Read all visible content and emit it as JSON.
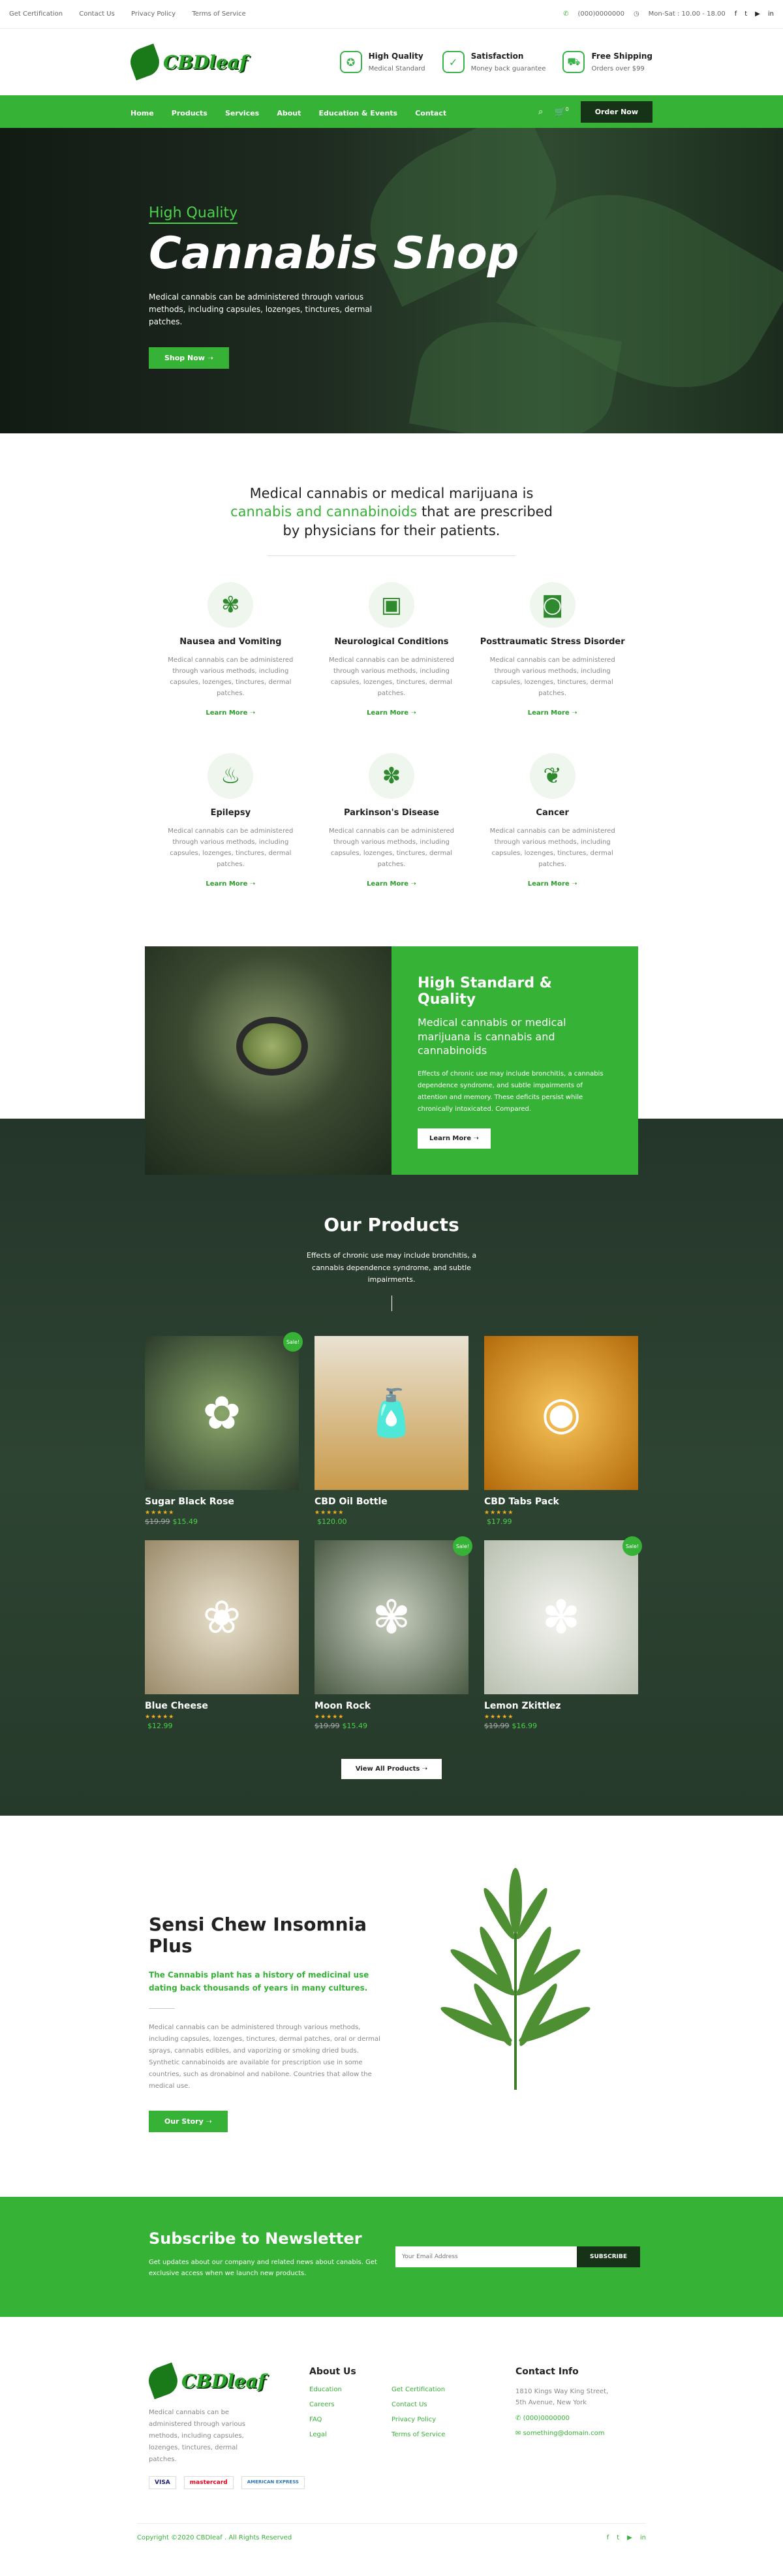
{
  "topbar": {
    "links": [
      "Get Certification",
      "Contact Us",
      "Privacy Policy",
      "Terms of Service"
    ],
    "phone": "(000)0000000",
    "hours": "Mon-Sat : 10.00 - 18.00"
  },
  "header": {
    "logo_text": "CBDleaf",
    "features": [
      {
        "icon": "award-icon",
        "title": "High Quality",
        "subtitle": "Medical Standard"
      },
      {
        "icon": "shield-check-icon",
        "title": "Satisfaction",
        "subtitle": "Money back guarantee"
      },
      {
        "icon": "truck-icon",
        "title": "Free Shipping",
        "subtitle": "Orders over $99"
      }
    ]
  },
  "nav": {
    "items": [
      "Home",
      "Products",
      "Services",
      "About",
      "Education & Events",
      "Contact"
    ],
    "cart_count": "0",
    "order_label": "Order Now"
  },
  "hero": {
    "eyebrow": "High Quality",
    "title": "Cannabis Shop",
    "text": "Medical cannabis can be administered through various methods, including capsules, lozenges, tinctures, dermal patches.",
    "button": "Shop Now"
  },
  "conditions": {
    "lead_1": "Medical cannabis or medical marijuana is",
    "lead_highlight": "cannabis and cannabinoids",
    "lead_2": "that are prescribed by physicians for their patients.",
    "items": [
      {
        "title": "Nausea and Vomiting",
        "text": "Medical cannabis can be administered through various methods, including capsules, lozenges, tinctures, dermal patches.",
        "more": "Learn More"
      },
      {
        "title": "Neurological Conditions",
        "text": "Medical cannabis can be administered through various methods, including capsules, lozenges, tinctures, dermal patches.",
        "more": "Learn More"
      },
      {
        "title": "Posttraumatic Stress Disorder",
        "text": "Medical cannabis can be administered through various methods, including capsules, lozenges, tinctures, dermal patches.",
        "more": "Learn More"
      },
      {
        "title": "Epilepsy",
        "text": "Medical cannabis can be administered through various methods, including capsules, lozenges, tinctures, dermal patches.",
        "more": "Learn More"
      },
      {
        "title": "Parkinson's Disease",
        "text": "Medical cannabis can be administered through various methods, including capsules, lozenges, tinctures, dermal patches.",
        "more": "Learn More"
      },
      {
        "title": "Cancer",
        "text": "Medical cannabis can be administered through various methods, including capsules, lozenges, tinctures, dermal patches.",
        "more": "Learn More"
      }
    ]
  },
  "quality": {
    "title": "High Standard & Quality",
    "subtitle": "Medical cannabis or medical marijuana is cannabis and cannabinoids",
    "text": "Effects of chronic use may include bronchitis, a cannabis dependence syndrome, and subtle impairments of attention and memory. These deficits persist while chronically intoxicated. Compared.",
    "button": "Learn More"
  },
  "products": {
    "title": "Our Products",
    "subtitle": "Effects of chronic use may include bronchitis, a cannabis dependence syndrome, and subtle impairments.",
    "sale_label": "Sale!",
    "items": [
      {
        "name": "Sugar Black Rose",
        "old": "$19.99",
        "price": "$15.49",
        "sale": true,
        "rating": "★★★★★"
      },
      {
        "name": "CBD Oil Bottle",
        "old": "",
        "price": "$120.00",
        "sale": false,
        "rating": "★★★★★"
      },
      {
        "name": "CBD Tabs Pack",
        "old": "",
        "price": "$17.99",
        "sale": false,
        "rating": "★★★★★"
      },
      {
        "name": "Blue Cheese",
        "old": "",
        "price": "$12.99",
        "sale": false,
        "rating": "★★★★★"
      },
      {
        "name": "Moon Rock",
        "old": "$19.99",
        "price": "$15.49",
        "sale": true,
        "rating": "★★★★★"
      },
      {
        "name": "Lemon Zkittlez",
        "old": "$19.99",
        "price": "$16.99",
        "sale": true,
        "rating": "★★★★★"
      }
    ],
    "view_all": "View All Products"
  },
  "sensi": {
    "title": "Sensi Chew Insomnia Plus",
    "highlight": "The Cannabis plant has a history of medicinal use dating back thousands of years in many cultures.",
    "text": "Medical cannabis can be administered through various methods, including capsules, lozenges, tinctures, dermal patches, oral or dermal sprays, cannabis edibles, and vaporizing or smoking dried buds. Synthetic cannabinoids are available for prescription use in some countries, such as dronabinol and nabilone. Countries that allow the medical use.",
    "button": "Our Story"
  },
  "newsletter": {
    "title": "Subscribe to Newsletter",
    "text": "Get updates about our company and related news about canabis. Get exclusive access when we launch new products.",
    "placeholder": "Your Email Address",
    "button": "SUBSCRIBE"
  },
  "footer": {
    "logo_text": "CBDleaf",
    "desc": "Medical cannabis can be administered through various methods, including capsules, lozenges, tinctures, dermal patches.",
    "payments": [
      "VISA",
      "mastercard",
      "AMERICAN EXPRESS"
    ],
    "about_title": "About Us",
    "about_links": [
      "Education",
      "Careers",
      "FAQ",
      "Legal"
    ],
    "more_links": [
      "Get Certification",
      "Contact Us",
      "Privacy Policy",
      "Terms of Service"
    ],
    "contact_title": "Contact Info",
    "address": "1810 Kings Way King Street, 5th Avenue, New York",
    "phone": "(000)0000000",
    "email": "something@domain.com",
    "copyright": "Copyright ©2020 CBDleaf . All Rights Reserved"
  },
  "colors": {
    "accent": "#36b236",
    "dark": "#173317"
  }
}
